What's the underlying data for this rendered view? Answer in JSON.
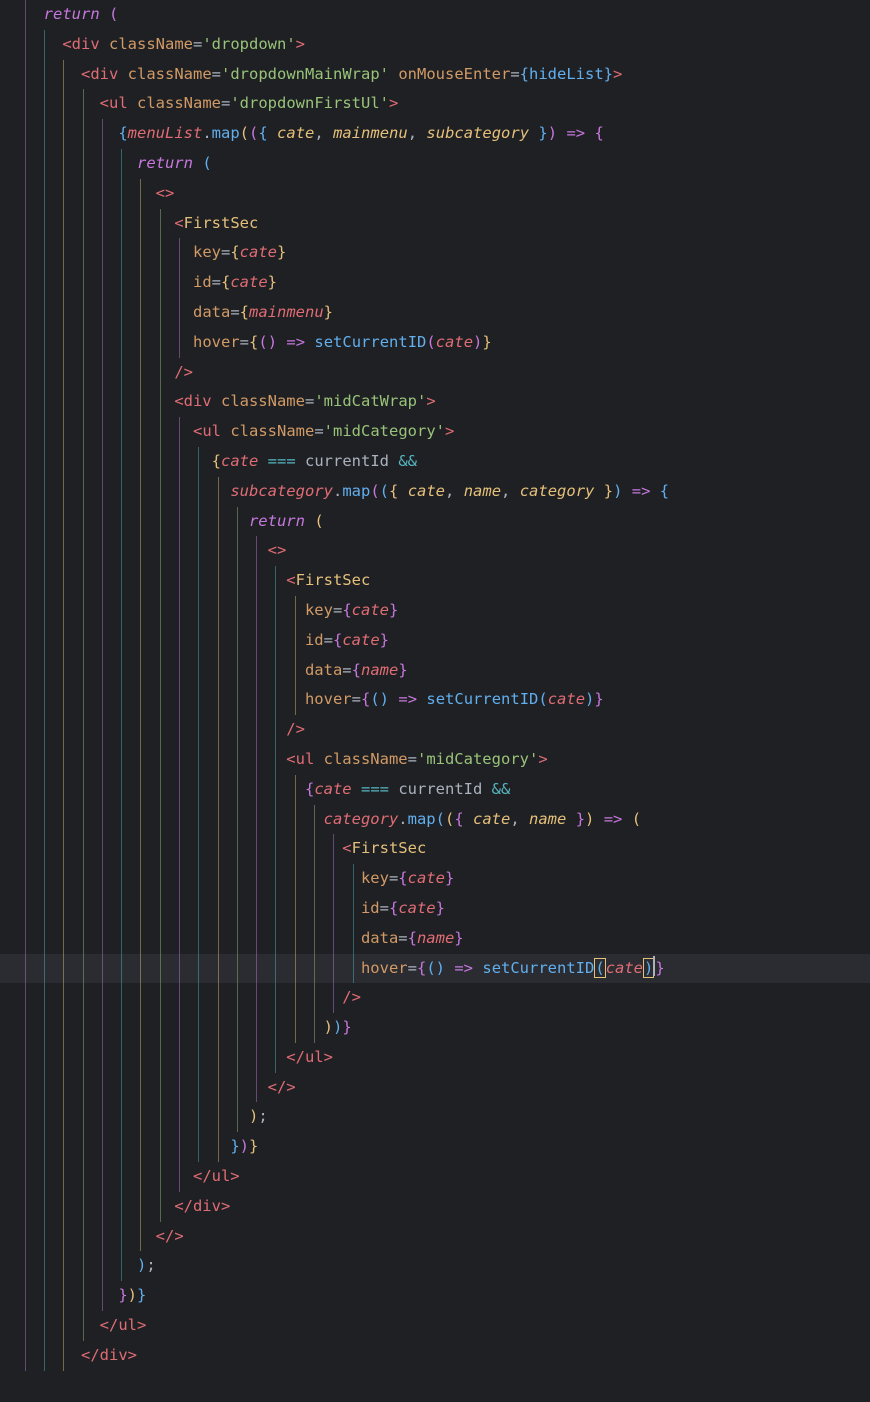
{
  "lines": {
    "l1": "return (",
    "l2a": "<div",
    "l2b": "className",
    "l2c": "'dropdown'",
    "l2d": ">",
    "l3a": "<div",
    "l3b": "className",
    "l3c": "'dropdownMainWrap'",
    "l3d": "onMouseEnter",
    "l3e": "hideList",
    "l3f": ">",
    "l4a": "<ul",
    "l4b": "className",
    "l4c": "'dropdownFirstUl'",
    "l4d": ">",
    "l5a": "menuList",
    "l5b": "map",
    "l5c": "cate",
    "l5d": "mainmenu",
    "l5e": "subcategory",
    "l6": "return (",
    "l7": "<>",
    "l8": "<FirstSec",
    "l9a": "key",
    "l9b": "cate",
    "l10a": "id",
    "l10b": "cate",
    "l11a": "data",
    "l11b": "mainmenu",
    "l12a": "hover",
    "l12b": "setCurrentID",
    "l12c": "cate",
    "l13": "/>",
    "l14a": "<div",
    "l14b": "className",
    "l14c": "'midCatWrap'",
    "l14d": ">",
    "l15a": "<ul",
    "l15b": "className",
    "l15c": "'midCategory'",
    "l15d": ">",
    "l16a": "cate",
    "l16b": "currentId",
    "l17a": "subcategory",
    "l17b": "map",
    "l17c": "cate",
    "l17d": "name",
    "l17e": "category",
    "l18": "return (",
    "l19": "<>",
    "l20": "<FirstSec",
    "l21a": "key",
    "l21b": "cate",
    "l22a": "id",
    "l22b": "cate",
    "l23a": "data",
    "l23b": "name",
    "l24a": "hover",
    "l24b": "setCurrentID",
    "l24c": "cate",
    "l25": "/>",
    "l26a": "<ul",
    "l26b": "className",
    "l26c": "'midCategory'",
    "l26d": ">",
    "l27a": "cate",
    "l27b": "currentId",
    "l28a": "category",
    "l28b": "map",
    "l28c": "cate",
    "l28d": "name",
    "l29": "<FirstSec",
    "l30a": "key",
    "l30b": "cate",
    "l31a": "id",
    "l31b": "cate",
    "l32a": "data",
    "l32b": "name",
    "l33a": "hover",
    "l33b": "setCurrentID",
    "l33c": "cate",
    "l34": "/>",
    "l35": "))",
    "l36": "</ul>",
    "l37": "</>",
    "l38": ");",
    "l39": "})",
    "l40": "</ul>",
    "l41": "</div>",
    "l42": "</>",
    "l43": ");",
    "l44": "})",
    "l45": "</ul>",
    "l46": "</div>"
  }
}
